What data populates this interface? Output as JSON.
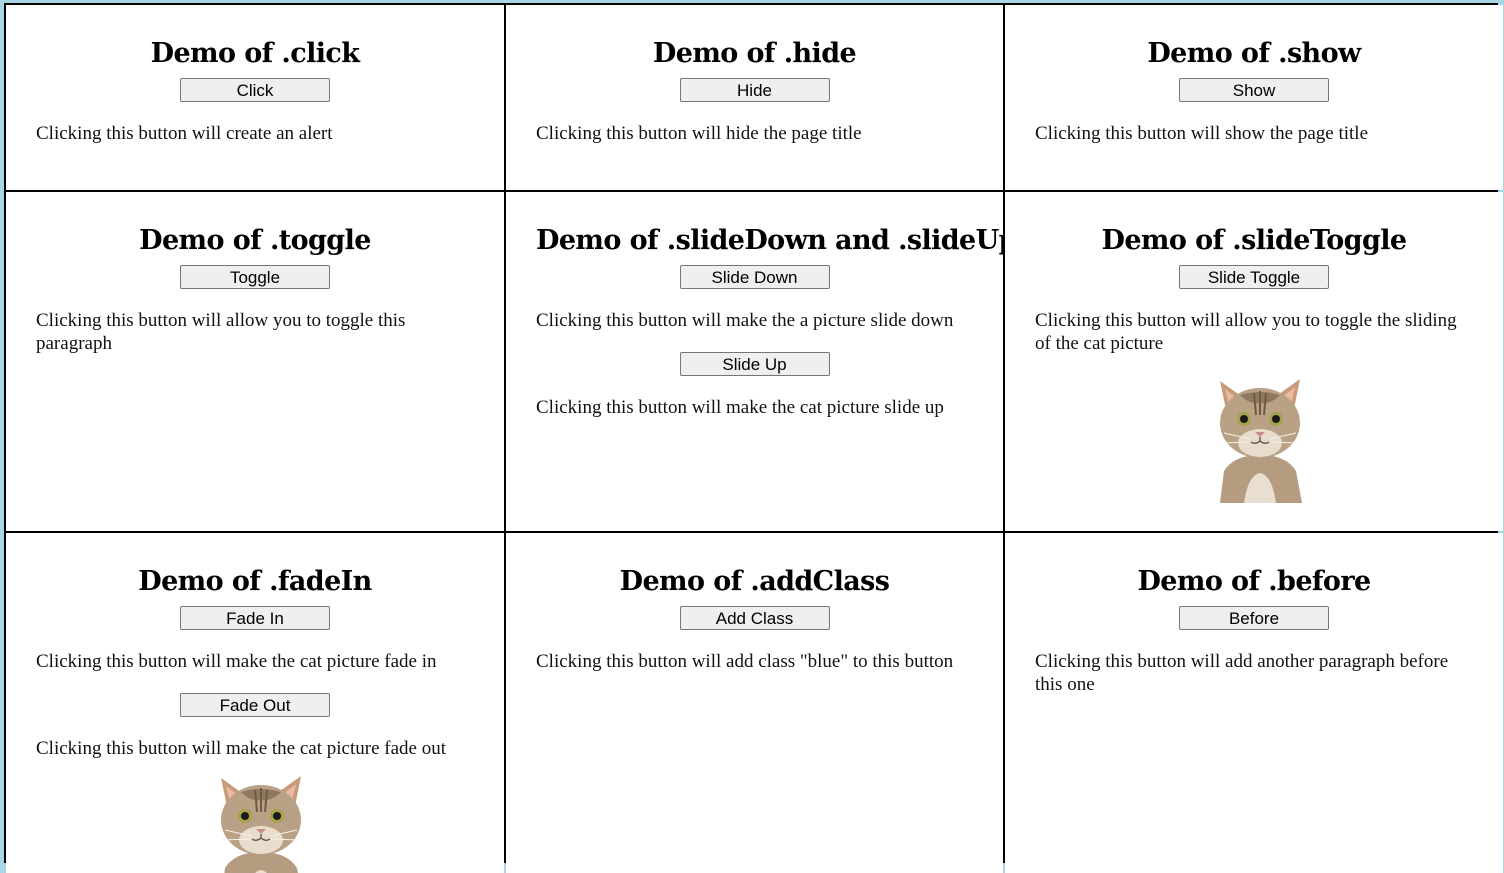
{
  "demos": [
    {
      "title": "Demo of .click",
      "button": "Click",
      "text": "Clicking this button will create an alert"
    },
    {
      "title": "Demo of .hide",
      "button": "Hide",
      "text": "Clicking this button will hide the page title"
    },
    {
      "title": "Demo of .show",
      "button": "Show",
      "text": "Clicking this button will show the page title"
    },
    {
      "title": "Demo of .toggle",
      "button": "Toggle",
      "text": "Clicking this button will allow you to toggle this paragraph"
    },
    {
      "title": "Demo of .slideDown and .slideUp",
      "button": "Slide Down",
      "text": "Clicking this button will make the a picture slide down",
      "button2": "Slide Up",
      "text2": "Clicking this button will make the cat picture slide up"
    },
    {
      "title": "Demo of .slideToggle",
      "button": "Slide Toggle",
      "text": "Clicking this button will allow you to toggle the sliding of the cat picture"
    },
    {
      "title": "Demo of .fadeIn",
      "button": "Fade In",
      "text": "Clicking this button will make the cat picture fade in",
      "button2": "Fade Out",
      "text2": "Clicking this button will make the cat picture fade out"
    },
    {
      "title": "Demo of .addClass",
      "button": "Add Class",
      "text": "Clicking this button will add class \"blue\" to this button"
    },
    {
      "title": "Demo of .before",
      "button": "Before",
      "text": "Clicking this button will add another paragraph before this one"
    }
  ],
  "colors": {
    "page_background": "#a9d6e5",
    "grid_lines": "#000000",
    "button_background": "#efefef"
  }
}
